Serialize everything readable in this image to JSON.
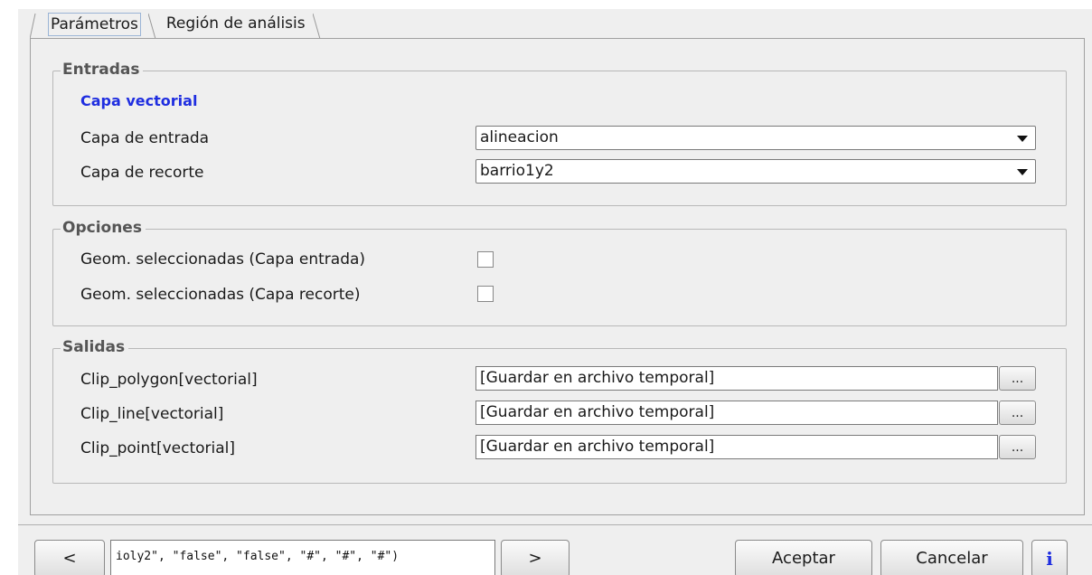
{
  "tabs": [
    {
      "label": "Parámetros",
      "active": true
    },
    {
      "label": "Región de análisis",
      "active": false
    }
  ],
  "entradas": {
    "title": "Entradas",
    "subheading": "Capa vectorial",
    "rows": [
      {
        "label": "Capa de entrada",
        "value": "alineacion"
      },
      {
        "label": "Capa de recorte",
        "value": "barrio1y2"
      }
    ]
  },
  "opciones": {
    "title": "Opciones",
    "rows": [
      {
        "label": "Geom. seleccionadas (Capa entrada)",
        "checked": false
      },
      {
        "label": "Geom. seleccionadas (Capa recorte)",
        "checked": false
      }
    ]
  },
  "salidas": {
    "title": "Salidas",
    "browse_label": "...",
    "rows": [
      {
        "label": "Clip_polygon[vectorial]",
        "value": "[Guardar en archivo temporal]"
      },
      {
        "label": "Clip_line[vectorial]",
        "value": "[Guardar en archivo temporal]"
      },
      {
        "label": "Clip_point[vectorial]",
        "value": "[Guardar en archivo temporal]"
      }
    ]
  },
  "bottom": {
    "prev_label": "<",
    "command_text": "ioly2\", \"false\", \"false\", \"#\", \"#\", \"#\")",
    "next_label": ">",
    "accept_label": "Aceptar",
    "cancel_label": "Cancelar",
    "info_label": "i"
  },
  "colors": {
    "heading_blue": "#1f2ee0",
    "group_title": "#555555",
    "background": "#efefef"
  }
}
